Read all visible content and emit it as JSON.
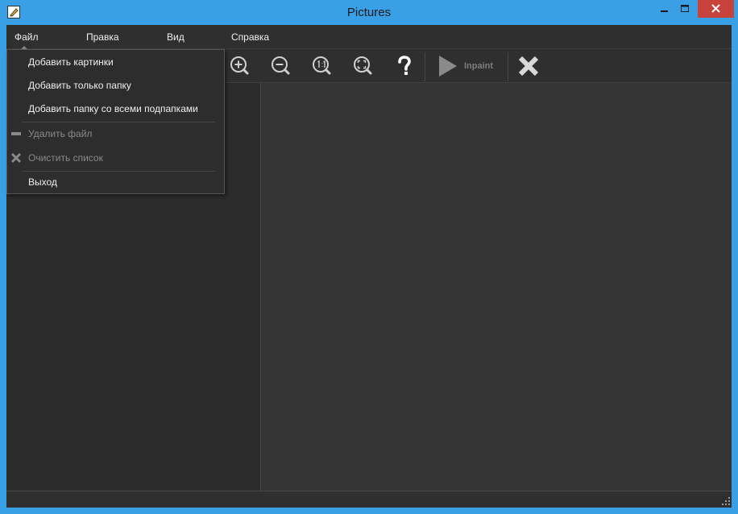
{
  "window": {
    "title": "Pictures"
  },
  "menubar": {
    "file": "Файл",
    "edit": "Правка",
    "view": "Вид",
    "help": "Справка"
  },
  "toolbar": {
    "zoom_in_icon": "zoom-in-icon",
    "zoom_out_icon": "zoom-out-icon",
    "actual_size_icon": "actual-size-icon",
    "fit_icon": "fit-to-window-icon",
    "help_icon": "question-icon",
    "inpaint_label": "Inpaint",
    "cancel_icon": "close-icon"
  },
  "file_menu": {
    "items": [
      {
        "label": "Добавить картинки",
        "enabled": true
      },
      {
        "label": "Добавить только папку",
        "enabled": true
      },
      {
        "label": "Добавить папку со всеми подпапками",
        "enabled": true
      },
      {
        "label": "Удалить файл",
        "enabled": false,
        "icon": "minus-icon"
      },
      {
        "label": "Очистить список",
        "enabled": false,
        "icon": "x-icon"
      },
      {
        "label": "Выход",
        "enabled": true
      }
    ]
  },
  "colors": {
    "title_bar": "#3aa0e6",
    "close_button": "#c7423a",
    "panel_background": "#2f2f2f",
    "canvas_background": "#353535",
    "text": "#f0f0f0",
    "disabled_text": "#8a8a8a"
  }
}
